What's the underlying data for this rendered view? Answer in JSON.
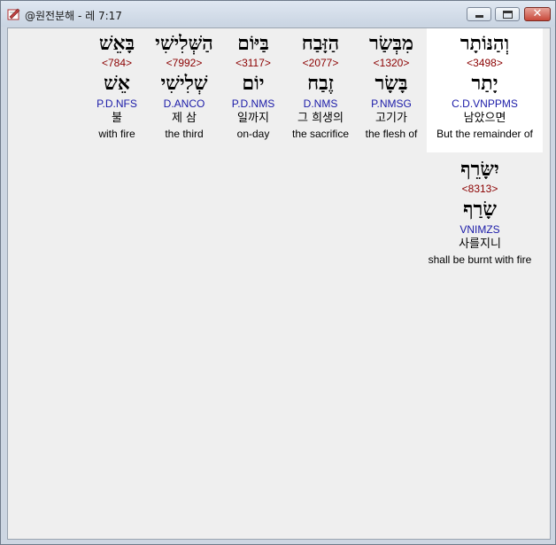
{
  "window": {
    "title": "@원전분해 - 레 7:17",
    "minimize_symbol": "",
    "maximize_symbol": "",
    "close_symbol": "✕",
    "colors": {
      "strong_number": "#8b0000",
      "parsing": "#1a1aa8",
      "selected_bg": "#ffffff"
    }
  },
  "words": [
    {
      "hebrew": "וְהַנּוֹתָר",
      "strong": "<3498>",
      "lemma": "יָתַר",
      "parsing": "C.D.VNPPMS",
      "korean": "남았으면",
      "english": "But the remainder of",
      "selected": true
    },
    {
      "hebrew": "מִבְּשַׂר",
      "strong": "<1320>",
      "lemma": "בָּשָׂר",
      "parsing": "P.NMSG",
      "korean": "고기가",
      "english": "the flesh of",
      "selected": false
    },
    {
      "hebrew": "הַזָּבַח",
      "strong": "<2077>",
      "lemma": "זֶבַח",
      "parsing": "D.NMS",
      "korean": "그 희생의",
      "english": "the sacrifice",
      "selected": false
    },
    {
      "hebrew": "בַּיּוֹם",
      "strong": "<3117>",
      "lemma": "יוֹם",
      "parsing": "P.D.NMS",
      "korean": "일까지",
      "english": "on-day",
      "selected": false
    },
    {
      "hebrew": "הַשְּׁלִישִׁי",
      "strong": "<7992>",
      "lemma": "שְׁלִישִׁי",
      "parsing": "D.ANCO",
      "korean": "제 삼",
      "english": "the third",
      "selected": false
    },
    {
      "hebrew": "בָּאֵשׁ",
      "strong": "<784>",
      "lemma": "אֵשׁ",
      "parsing": "P.D.NFS",
      "korean": "불",
      "english": "with fire",
      "selected": false
    },
    {
      "hebrew": "יִשָּׂרֵף",
      "strong": "<8313>",
      "lemma": "שָׂרַף",
      "parsing": "VNIMZS",
      "korean": "사를지니",
      "english": "shall be burnt with fire",
      "selected": false
    }
  ]
}
